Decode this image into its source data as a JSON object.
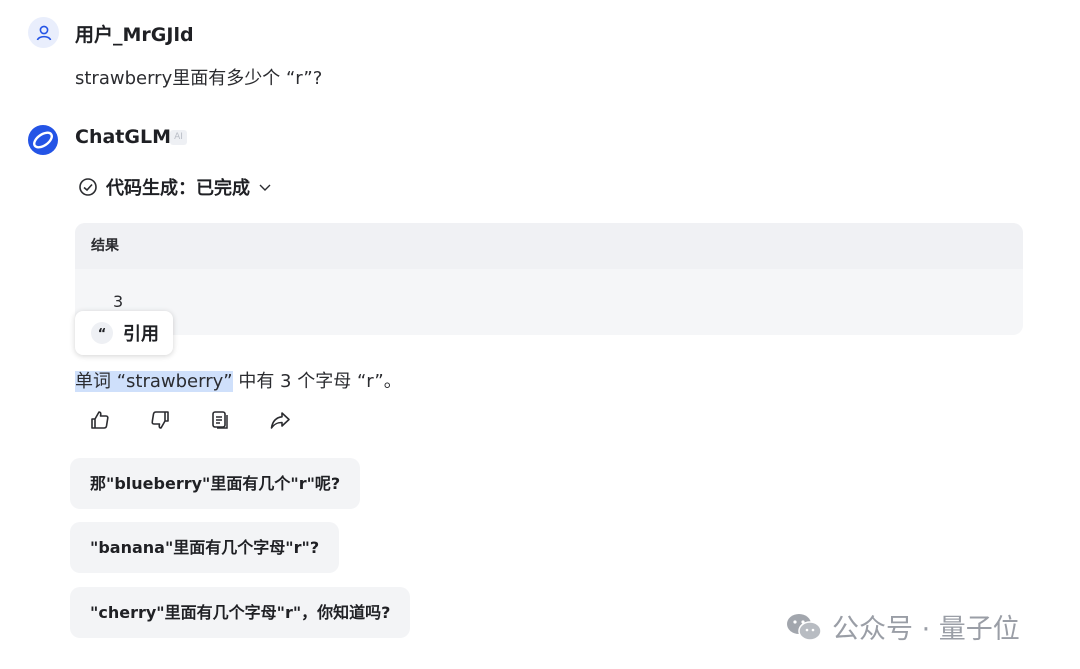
{
  "user": {
    "name": "用户_MrGJld",
    "question": "strawberry里面有多少个 “r”?"
  },
  "bot": {
    "name": "ChatGLM",
    "badge": "AI"
  },
  "status": {
    "label": "代码生成：已完成"
  },
  "result": {
    "header": "结果",
    "value": "3"
  },
  "quote_popup": {
    "label": "引用"
  },
  "answer": {
    "highlighted": "单词 “strawberry”",
    "rest": " 中有 3 个字母 “r”。"
  },
  "actions": [
    "thumbs-up-icon",
    "thumbs-down-icon",
    "copy-icon",
    "share-icon"
  ],
  "suggestions": [
    "那\"blueberry\"里面有几个\"r\"呢?",
    "\"banana\"里面有几个字母\"r\"?",
    "\"cherry\"里面有几个字母\"r\"，你知道吗?"
  ],
  "watermark": {
    "text": "公众号 · 量子位"
  },
  "colors": {
    "accent": "#2454e6",
    "highlight": "#cfe0fb",
    "card": "#f5f6f8"
  }
}
